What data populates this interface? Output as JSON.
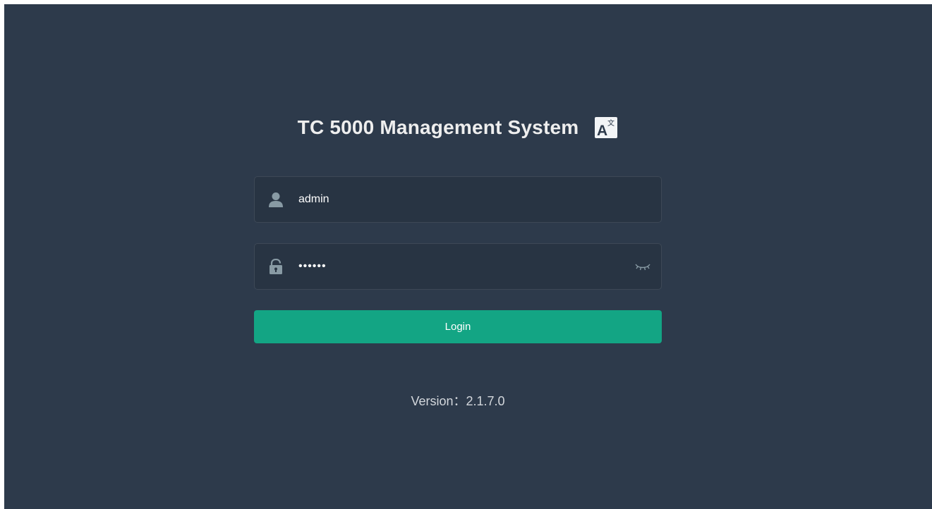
{
  "login": {
    "title": "TC 5000 Management System",
    "language_icon": "translate-icon",
    "username": {
      "icon": "user-icon",
      "value": "admin"
    },
    "password": {
      "icon": "lock-icon",
      "value": "••••••",
      "visibility_icon": "eye-closed-icon"
    },
    "login_label": "Login",
    "version": "Version：2.1.7.0"
  },
  "colors": {
    "background": "#2d3a4b",
    "field_background": "#283443",
    "accent": "#13a584",
    "title_text": "#eeeeee",
    "icon": "#889aa4"
  }
}
